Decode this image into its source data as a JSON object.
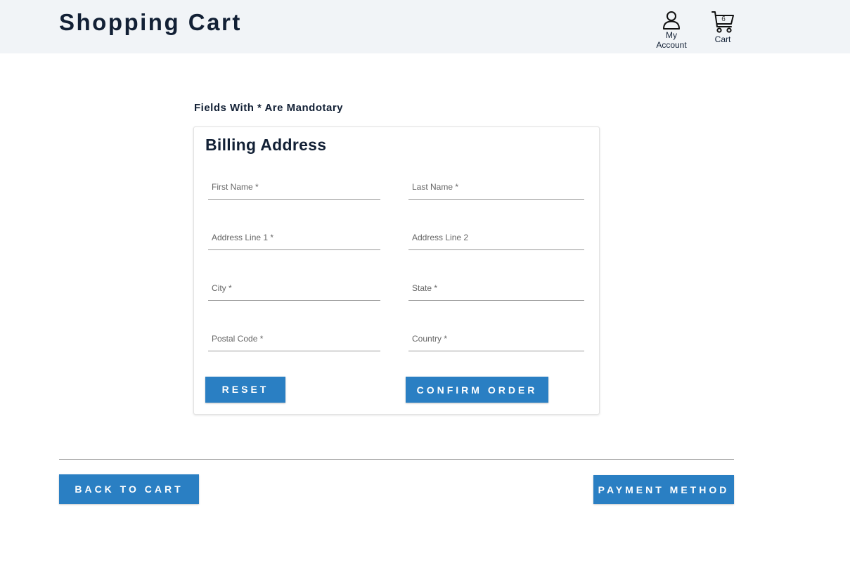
{
  "header": {
    "title": "Shopping Cart",
    "account_label_line1": "My",
    "account_label_line2": "Account",
    "cart_label": "Cart",
    "cart_count": "6"
  },
  "form": {
    "mandatory_note": "Fields With * Are Mandotary",
    "title": "Billing Address",
    "fields": {
      "first_name": {
        "label": "First Name *",
        "value": ""
      },
      "last_name": {
        "label": "Last Name *",
        "value": ""
      },
      "address_line_1": {
        "label": "Address Line 1 *",
        "value": ""
      },
      "address_line_2": {
        "label": "Address Line 2",
        "value": ""
      },
      "city": {
        "label": "City *",
        "value": ""
      },
      "state": {
        "label": "State *",
        "value": ""
      },
      "postal_code": {
        "label": "Postal Code *",
        "value": ""
      },
      "country": {
        "label": "Country *",
        "value": ""
      }
    },
    "reset_label": "RESET",
    "confirm_label": "CONFIRM ORDER"
  },
  "footer": {
    "back_label": "BACK TO CART",
    "payment_label": "PAYMENT METHOD"
  },
  "colors": {
    "accent": "#2a7fc3",
    "header_bg": "#f1f4f7",
    "text_dark": "#122035"
  },
  "icons": {
    "account": "user-icon",
    "cart": "shopping-cart-icon"
  }
}
